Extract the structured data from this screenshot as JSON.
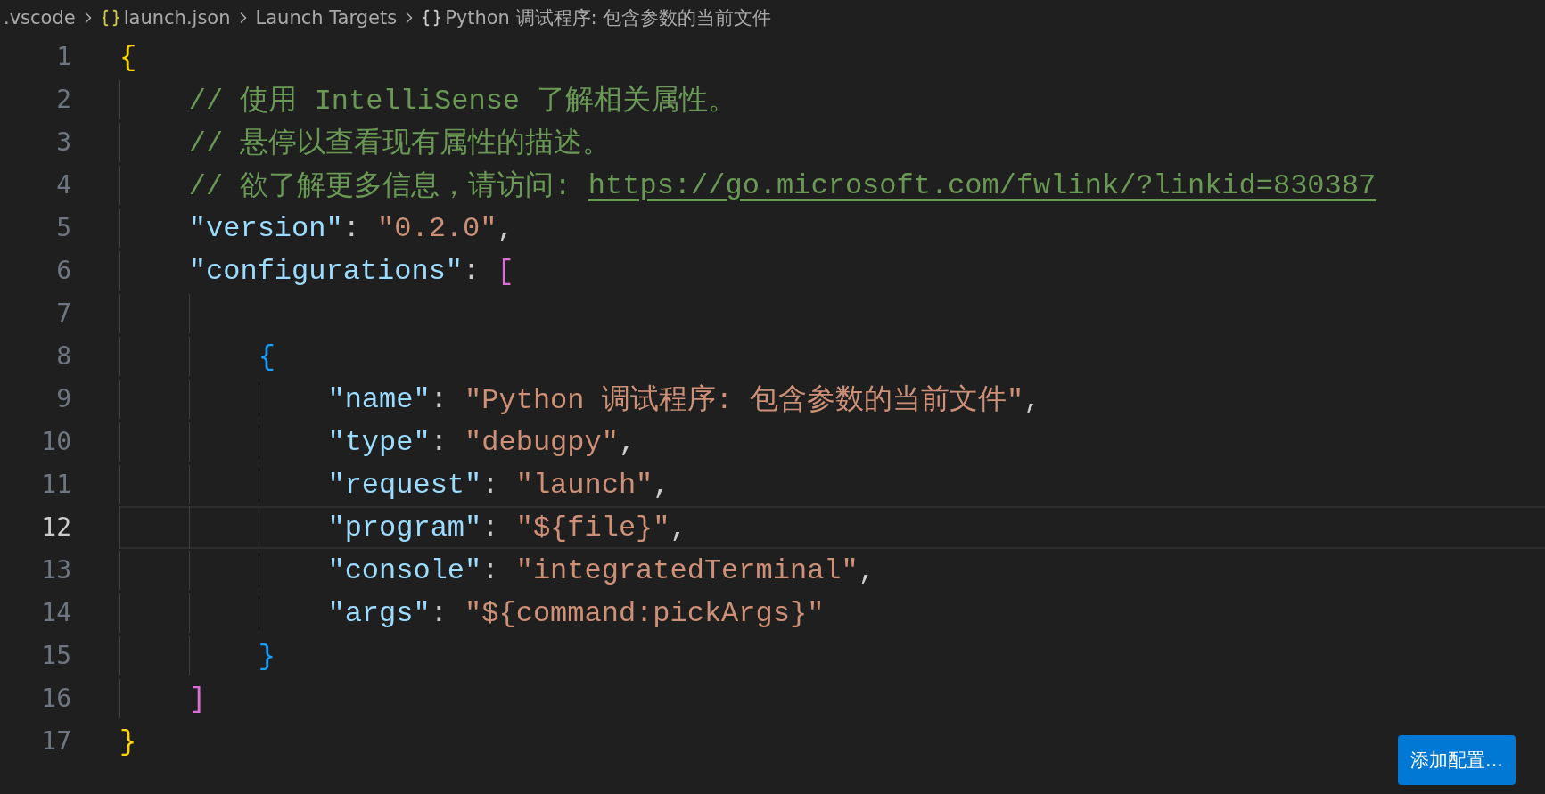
{
  "breadcrumb": [
    {
      "label": ".vscode",
      "kind": "folder"
    },
    {
      "label": "launch.json",
      "kind": "file"
    },
    {
      "label": "Launch Targets",
      "kind": "section"
    },
    {
      "label": "Python 调试程序: 包含参数的当前文件",
      "kind": "object"
    }
  ],
  "editor": {
    "lines": [
      {
        "number": "1",
        "current": false,
        "tokens": [
          {
            "kind": "brace1",
            "text": "{"
          }
        ],
        "children": [
          {
            "number": "2",
            "current": false,
            "tokens": [
              {
                "kind": "comment",
                "text": "// 使用 IntelliSense 了解相关属性。"
              }
            ]
          },
          {
            "number": "3",
            "current": false,
            "tokens": [
              {
                "kind": "comment",
                "text": "// 悬停以查看现有属性的描述。"
              }
            ]
          },
          {
            "number": "4",
            "current": false,
            "tokens": [
              {
                "kind": "comment",
                "text": "// 欲了解更多信息，请访问: "
              },
              {
                "kind": "link",
                "text": "https://go.microsoft.com/fwlink/?linkid=830387"
              }
            ]
          },
          {
            "number": "5",
            "current": false,
            "tokens": [
              {
                "kind": "key",
                "text": "\"version\""
              },
              {
                "kind": "punct",
                "text": ": "
              },
              {
                "kind": "string",
                "text": "\"0.2.0\""
              },
              {
                "kind": "punct",
                "text": ","
              }
            ]
          },
          {
            "number": "6",
            "current": false,
            "tokens": [
              {
                "kind": "key",
                "text": "\"configurations\""
              },
              {
                "kind": "punct",
                "text": ": "
              },
              {
                "kind": "brace2",
                "text": "["
              }
            ],
            "children": [
              {
                "number": "7",
                "current": false
              },
              {
                "number": "8",
                "current": false,
                "tokens": [
                  {
                    "kind": "brace3",
                    "text": "{"
                  }
                ],
                "children": [
                  {
                    "number": "9",
                    "current": false,
                    "tokens": [
                      {
                        "kind": "key",
                        "text": "\"name\""
                      },
                      {
                        "kind": "punct",
                        "text": ": "
                      },
                      {
                        "kind": "string",
                        "text": "\"Python 调试程序: 包含参数的当前文件\""
                      },
                      {
                        "kind": "punct",
                        "text": ","
                      }
                    ]
                  },
                  {
                    "number": "10",
                    "current": false,
                    "tokens": [
                      {
                        "kind": "key",
                        "text": "\"type\""
                      },
                      {
                        "kind": "punct",
                        "text": ": "
                      },
                      {
                        "kind": "string",
                        "text": "\"debugpy\""
                      },
                      {
                        "kind": "punct",
                        "text": ","
                      }
                    ]
                  },
                  {
                    "number": "11",
                    "current": false,
                    "tokens": [
                      {
                        "kind": "key",
                        "text": "\"request\""
                      },
                      {
                        "kind": "punct",
                        "text": ": "
                      },
                      {
                        "kind": "string",
                        "text": "\"launch\""
                      },
                      {
                        "kind": "punct",
                        "text": ","
                      }
                    ]
                  },
                  {
                    "number": "12",
                    "current": true,
                    "tokens": [
                      {
                        "kind": "key",
                        "text": "\"program\""
                      },
                      {
                        "kind": "punct",
                        "text": ": "
                      },
                      {
                        "kind": "string",
                        "text": "\"${file}\""
                      },
                      {
                        "kind": "punct",
                        "text": ","
                      }
                    ]
                  },
                  {
                    "number": "13",
                    "current": false,
                    "tokens": [
                      {
                        "kind": "key",
                        "text": "\"console\""
                      },
                      {
                        "kind": "punct",
                        "text": ": "
                      },
                      {
                        "kind": "string",
                        "text": "\"integratedTerminal\""
                      },
                      {
                        "kind": "punct",
                        "text": ","
                      }
                    ]
                  },
                  {
                    "number": "14",
                    "current": false,
                    "tokens": [
                      {
                        "kind": "key",
                        "text": "\"args\""
                      },
                      {
                        "kind": "punct",
                        "text": ": "
                      },
                      {
                        "kind": "string",
                        "text": "\"${command:pickArgs}\""
                      }
                    ]
                  }
                ]
              },
              {
                "number": "15",
                "current": false,
                "tokens": [
                  {
                    "kind": "brace3",
                    "text": "}"
                  }
                ]
              }
            ]
          },
          {
            "number": "16",
            "current": false,
            "tokens": [
              {
                "kind": "brace2",
                "text": "]"
              }
            ]
          }
        ]
      },
      {
        "number": "17",
        "current": false,
        "tokens": [
          {
            "kind": "brace1",
            "text": "}"
          }
        ]
      }
    ]
  },
  "add_button": "添加配置..."
}
